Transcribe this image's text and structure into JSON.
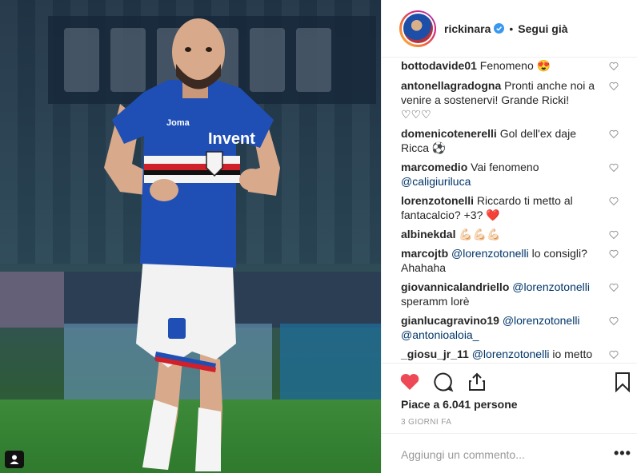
{
  "post": {
    "username": "rickinara",
    "follow_status": "Segui già",
    "separator": "•",
    "likes_text": "Piace a 6.041 persone",
    "date_text": "3 GIORNI FA",
    "comment_placeholder": "Aggiungi un commento...",
    "more_options": "•••"
  },
  "photo": {
    "jersey_sponsor": "Invent",
    "jersey_brand": "Joma"
  },
  "colors": {
    "like_red": "#ed4956",
    "verified_blue": "#3897f0",
    "mention_blue": "#003569",
    "jersey_blue": "#1f4fb5"
  },
  "comments": [
    {
      "user": "bottodavide01",
      "text": "Fenomeno 😍",
      "mention": ""
    },
    {
      "user": "antonellagradogna",
      "text": "Pronti anche noi a venire a sostenervi! Grande Ricki! ♡♡♡",
      "mention": ""
    },
    {
      "user": "domenicotenerelli",
      "text": "Gol dell'ex daje Ricca ⚽",
      "mention": ""
    },
    {
      "user": "marcomedio",
      "text": "Vai fenomeno",
      "mention": "@caligiuriluca"
    },
    {
      "user": "lorenzotonelli",
      "text": "Riccardo ti metto al fantacalcio? +3? ❤️",
      "mention": ""
    },
    {
      "user": "albinekdal",
      "text": "💪🏻💪🏻💪🏻",
      "mention": ""
    },
    {
      "user": "marcojtb",
      "text": "lo consigli? Ahahaha",
      "mention": "@lorenzotonelli"
    },
    {
      "user": "giovannicalandriello",
      "text": "speramm lorè",
      "mention": "@lorenzotonelli"
    },
    {
      "user": "gianlucagravino19",
      "text": "",
      "mention": "@lorenzotonelli @antonioaloia_"
    },
    {
      "user": "_giosu_jr_11",
      "text": "io metto",
      "mention": "@lorenzotonelli"
    }
  ]
}
